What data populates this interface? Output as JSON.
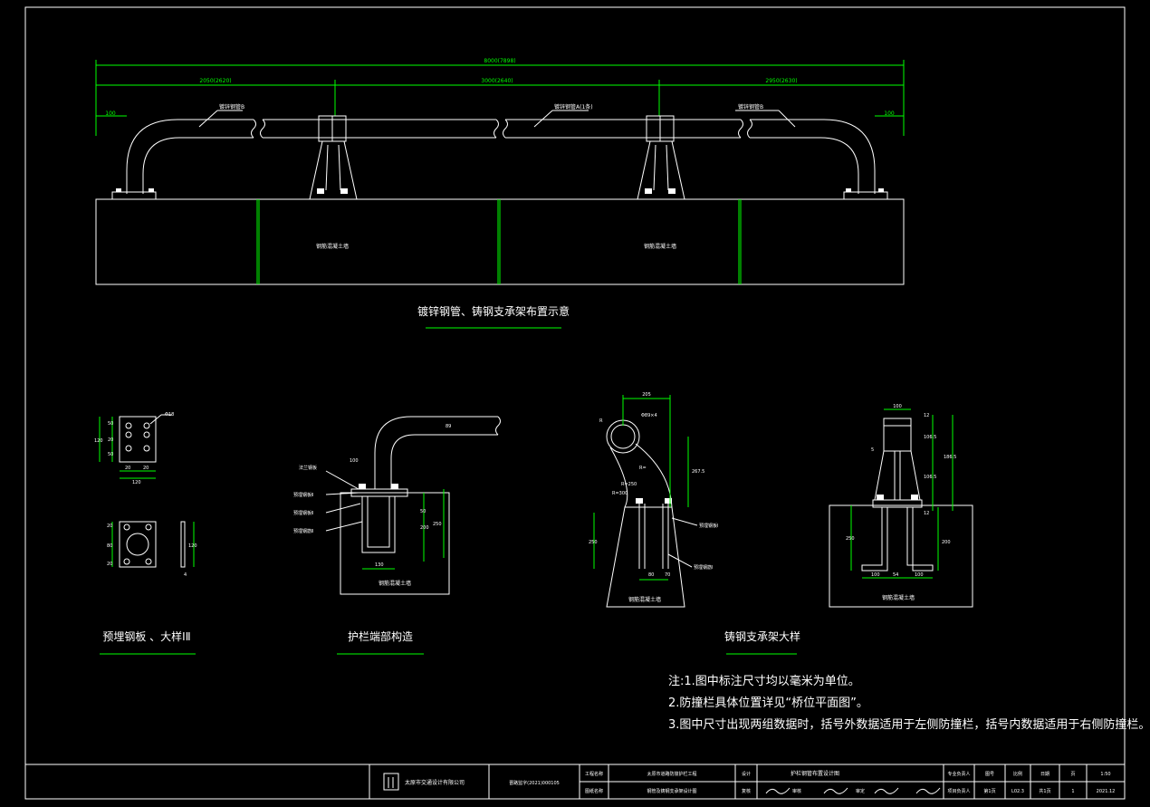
{
  "titles": {
    "layout": "镀锌钢管、铸钢支承架布置示意",
    "plate": "预埋钢板 、大样ⅠⅡ",
    "end": "护栏端部构造",
    "support": "铸钢支承架大样"
  },
  "notes": [
    "注:1.图中标注尺寸均以毫米为单位。",
    "2.防撞栏具体位置详见“桥位平面图”。",
    "3.图中尺寸出现两组数据时，括号外数据适用于左侧防撞栏，括号内数据适用于右侧防撞栏。"
  ],
  "layout_dims": {
    "total": "8000(7898)",
    "left": "2050(2620)",
    "middle": "3000(2640)",
    "right": "2950(2630)",
    "end_left": "100",
    "end_right": "100"
  },
  "layout_labels": {
    "pipe_b_left": "镀锌钢管B",
    "pipe_a": "镀锌钢管A(1条)",
    "pipe_b_right": "镀锌钢管B",
    "wall1": "钢筋混凝土墙",
    "wall2": "钢筋混凝土墙"
  },
  "plate_dims": {
    "d1": "50",
    "d2": "20",
    "d3": "50",
    "h": "120",
    "w1": "20",
    "w2": "20",
    "wt": "120",
    "hole": "Φ18",
    "b1": "20",
    "b2": "80",
    "b3": "20",
    "bh": "120",
    "t": "4"
  },
  "end_labels": {
    "l1": "法兰钢板",
    "l2": "预埋钢板Ⅱ",
    "l3": "预埋钢板Ⅱ",
    "l4": "预埋钢筋Ⅱ",
    "top": "100",
    "d": "89",
    "v1": "50",
    "v2": "200",
    "v3": "250",
    "bot": "130",
    "wall": "钢筋混凝土墙"
  },
  "support_labels": {
    "w205": "205",
    "phi": "Φ89×4",
    "r": "R",
    "r2": "R=",
    "d1": "267.5",
    "a1": "R=250",
    "a2": "R=300",
    "v250": "250",
    "b1": "80",
    "b2": "70",
    "l1": "预埋钢板Ⅰ",
    "l2": "预埋钢筋Ⅰ",
    "wall": "钢筋混凝土墙",
    "top": "100",
    "s1": "12",
    "s2": "106.5",
    "s3": "106.5",
    "s4": "186.5",
    "s5": "12",
    "h250": "250",
    "h200": "200",
    "f1": "100",
    "f2": "54",
    "f3": "100",
    "e": "5",
    "wall2": "钢筋混凝土墙"
  },
  "title_block": {
    "company": "太原市交通设计有限公司",
    "project_code": "晋路监字(2021)000105",
    "c1": "工程名称",
    "c1v": "太原市道路防撞护栏工程",
    "c2": "图纸名称",
    "c2v": "钢管及铸钢支承架设计图",
    "c3": "设计",
    "c4": "复核",
    "c5": "审核",
    "c6": "审定",
    "c7": "专业负责人",
    "c8": "项目负责人",
    "c9": "图号",
    "c10": "比例",
    "c11": "日期",
    "c12": "页",
    "top_title": "护栏钢管布置设计图",
    "scale": "1:50",
    "no": "L02.3",
    "page": "1",
    "date": "2021.12",
    "sh1": "第1页",
    "sh2": "共1页"
  }
}
